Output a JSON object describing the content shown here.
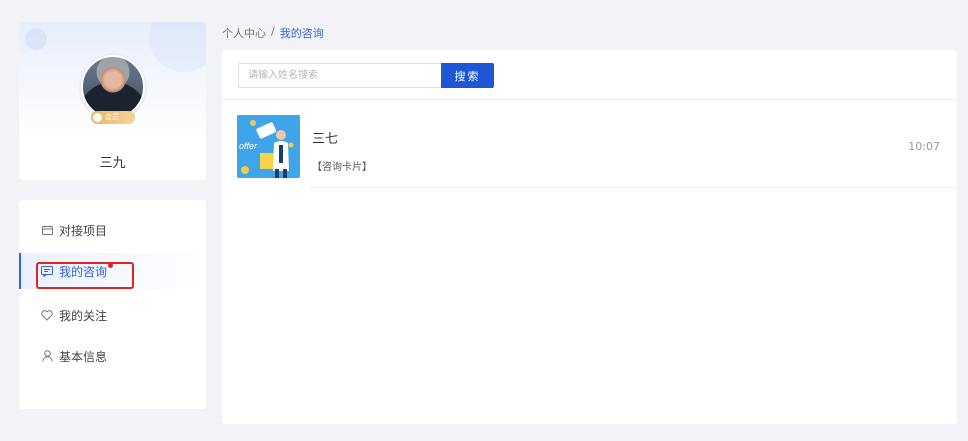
{
  "user": {
    "name": "三九",
    "badge": "会员"
  },
  "sidebar": {
    "items": [
      {
        "label": "对接项目",
        "icon": "project-icon"
      },
      {
        "label": "我的咨询",
        "icon": "chat-icon",
        "active": true,
        "unread": true
      },
      {
        "label": "我的关注",
        "icon": "heart-icon"
      },
      {
        "label": "基本信息",
        "icon": "user-icon"
      }
    ]
  },
  "breadcrumb": {
    "root": "个人中心",
    "separator": "/",
    "current": "我的咨询"
  },
  "search": {
    "placeholder": "请输入姓名搜索",
    "value": "",
    "button_label": "搜索"
  },
  "messages": [
    {
      "name": "三七",
      "preview": "【咨询卡片】",
      "time": "10:07",
      "thumb_text": "offer"
    }
  ],
  "colors": {
    "accent": "#1f56d6",
    "highlight": "#e02424",
    "background": "#f1f3f7"
  }
}
